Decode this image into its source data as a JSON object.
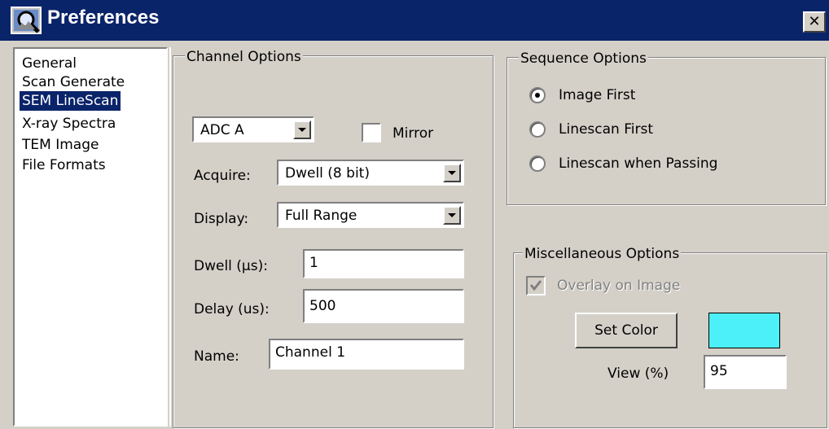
{
  "window": {
    "title": "Preferences",
    "close_glyph": "✕"
  },
  "nav": {
    "items": [
      "General",
      "Scan Generate",
      "SEM LineScan",
      "X-ray Spectra",
      "TEM Image",
      "File Formats"
    ],
    "selected": "SEM LineScan"
  },
  "channel": {
    "legend": "Channel Options",
    "adc_value": "ADC A",
    "mirror_label": "Mirror",
    "mirror_checked": false,
    "acquire_label": "Acquire:",
    "acquire_value": "Dwell (8 bit)",
    "display_label": "Display:",
    "display_value": "Full Range",
    "dwell_label": "Dwell (µs):",
    "dwell_value": "1",
    "delay_label": "Delay (us):",
    "delay_value": "500",
    "name_label": "Name:",
    "name_value": "Channel 1"
  },
  "sequence": {
    "legend": "Sequence Options",
    "options": [
      "Image First",
      "Linescan First",
      "Linescan when Passing"
    ],
    "selected": "Image First"
  },
  "misc": {
    "legend": "Miscellaneous Options",
    "overlay_label": "Overlay on Image",
    "overlay_checked": true,
    "overlay_enabled": false,
    "set_color_label": "Set Color",
    "color": "#4cf0f8",
    "view_label": "View (%)",
    "view_value": "95"
  },
  "colors": {
    "titlebar": "#0a246a",
    "selection": "#0a246a",
    "face": "#d4d0c8"
  }
}
